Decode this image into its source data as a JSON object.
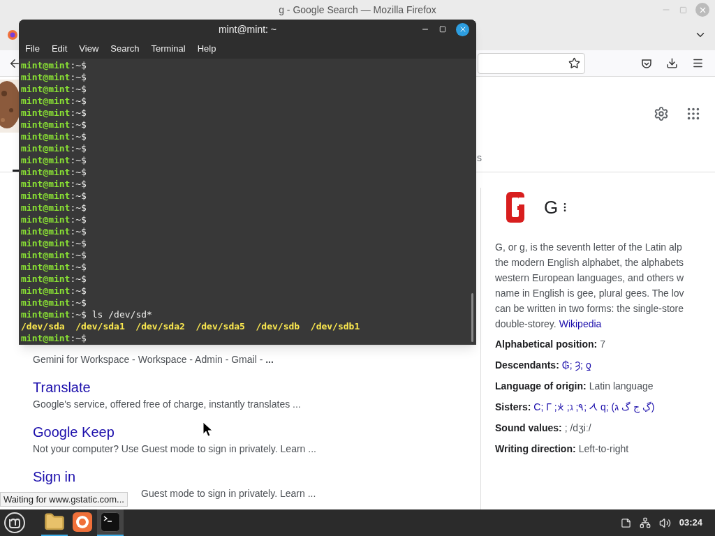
{
  "firefox": {
    "title": "g - Google Search — Mozilla Firefox",
    "status": "Waiting for www.gstatic.com..."
  },
  "terminal": {
    "title": "mint@mint: ~",
    "menu": [
      "File",
      "Edit",
      "View",
      "Search",
      "Terminal",
      "Help"
    ],
    "lines": [
      {
        "kind": "prompt",
        "user": "mint@mint",
        "path": ":~$"
      },
      {
        "kind": "prompt",
        "user": "mint@mint",
        "path": ":~$"
      },
      {
        "kind": "prompt",
        "user": "mint@mint",
        "path": ":~$"
      },
      {
        "kind": "prompt",
        "user": "mint@mint",
        "path": ":~$"
      },
      {
        "kind": "prompt",
        "user": "mint@mint",
        "path": ":~$"
      },
      {
        "kind": "prompt",
        "user": "mint@mint",
        "path": ":~$"
      },
      {
        "kind": "prompt",
        "user": "mint@mint",
        "path": ":~$"
      },
      {
        "kind": "prompt",
        "user": "mint@mint",
        "path": ":~$"
      },
      {
        "kind": "prompt",
        "user": "mint@mint",
        "path": ":~$"
      },
      {
        "kind": "prompt",
        "user": "mint@mint",
        "path": ":~$"
      },
      {
        "kind": "prompt",
        "user": "mint@mint",
        "path": ":~$"
      },
      {
        "kind": "prompt",
        "user": "mint@mint",
        "path": ":~$"
      },
      {
        "kind": "prompt",
        "user": "mint@mint",
        "path": ":~$"
      },
      {
        "kind": "prompt",
        "user": "mint@mint",
        "path": ":~$"
      },
      {
        "kind": "prompt",
        "user": "mint@mint",
        "path": ":~$"
      },
      {
        "kind": "prompt",
        "user": "mint@mint",
        "path": ":~$"
      },
      {
        "kind": "prompt",
        "user": "mint@mint",
        "path": ":~$"
      },
      {
        "kind": "prompt",
        "user": "mint@mint",
        "path": ":~$"
      },
      {
        "kind": "prompt",
        "user": "mint@mint",
        "path": ":~$"
      },
      {
        "kind": "prompt",
        "user": "mint@mint",
        "path": ":~$"
      },
      {
        "kind": "prompt",
        "user": "mint@mint",
        "path": ":~$"
      },
      {
        "kind": "prompt",
        "user": "mint@mint",
        "path": ":~$",
        "command": "ls /dev/sd*"
      },
      {
        "kind": "output",
        "items": [
          "/dev/sda",
          "/dev/sda1",
          "/dev/sda2",
          "/dev/sda5",
          "/dev/sdb",
          "/dev/sdb1"
        ]
      },
      {
        "kind": "prompt",
        "user": "mint@mint",
        "path": ":~$"
      }
    ]
  },
  "google": {
    "partial_tab": "s",
    "results": [
      {
        "snippet": "Gemini for Workspace - Workspace - Admin - Gmail - **...**"
      },
      {
        "title": "Translate",
        "snippet": "Google's service, offered free of charge, instantly translates ..."
      },
      {
        "title": "Google Keep",
        "snippet": "Not your computer? Use Guest mode to sign in privately. Learn ..."
      },
      {
        "title": "Sign in",
        "snippet": "Guest mode to sign in privately. Learn ..."
      }
    ],
    "knowledge": {
      "title": "G",
      "description": [
        "G, or g, is the seventh letter of the Latin alp",
        "the modern English alphabet, the alphabets",
        "western European languages, and others w",
        "name in English is gee, plural gees. The lov",
        "can be written in two forms: the single-store",
        "double-storey."
      ],
      "source": "Wikipedia",
      "facts": [
        {
          "label": "Alphabetical position:",
          "value": "7",
          "link": false
        },
        {
          "label": "Descendants:",
          "value": "₲; Ȝ; ƍ",
          "link": true
        },
        {
          "label": "Language of origin:",
          "value": "Latin language",
          "link": false
        },
        {
          "label": "Sisters:",
          "value": "C; Γ ;𐠂 ;ℷ ;𐡂 ;٩ q; (ڲ ج گ ג)",
          "link": true
        },
        {
          "label": "Sound values:",
          "value": "; /dʒiː/",
          "link": false
        },
        {
          "label": "Writing direction:",
          "value": "Left-to-right",
          "link": false
        }
      ]
    }
  },
  "taskbar": {
    "apps": [
      {
        "kind": "files",
        "running": true,
        "selected": false
      },
      {
        "kind": "firefox",
        "running": false,
        "selected": false
      },
      {
        "kind": "terminal",
        "running": true,
        "selected": true
      }
    ],
    "clock": "03:24"
  }
}
